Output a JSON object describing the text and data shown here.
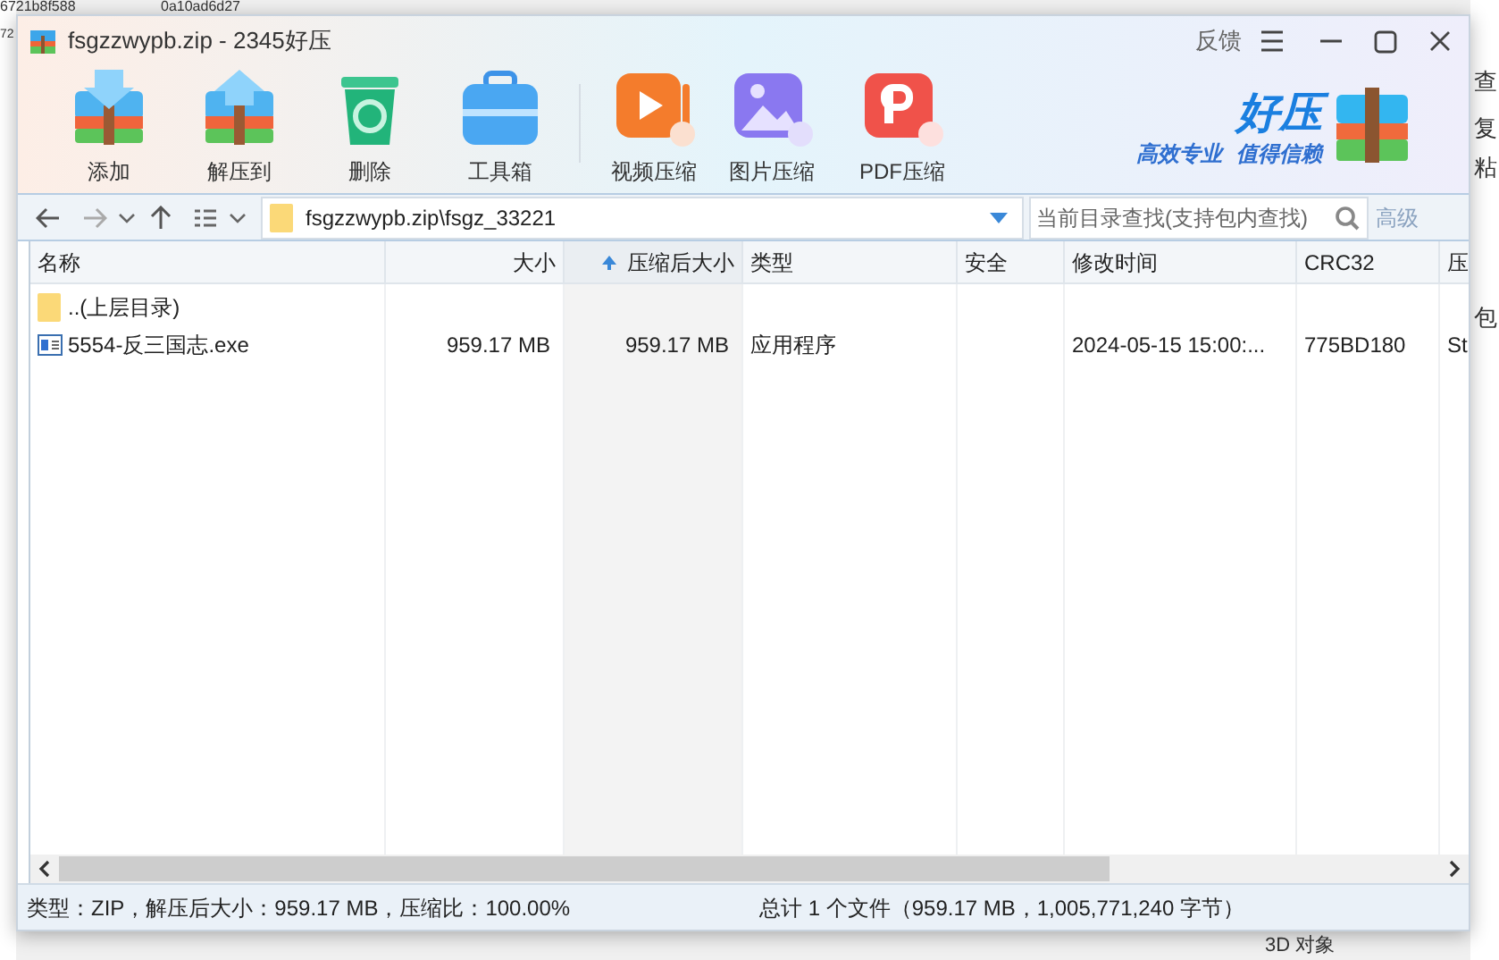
{
  "background": {
    "texts": [
      "6721b8f588",
      "0a10ad6d27",
      "72",
      "查",
      "复",
      "粘",
      "包",
      "3D 对象"
    ]
  },
  "window": {
    "title": "fsgzzwypb.zip - 2345好压",
    "feedback": "反馈"
  },
  "toolbar": [
    {
      "kind": "add",
      "label": "添加"
    },
    {
      "kind": "extract",
      "label": "解压到"
    },
    {
      "kind": "delete",
      "label": "删除"
    },
    {
      "kind": "tools",
      "label": "工具箱"
    },
    {
      "kind": "video",
      "label": "视频压缩"
    },
    {
      "kind": "image",
      "label": "图片压缩"
    },
    {
      "kind": "pdf",
      "label": "PDF压缩"
    }
  ],
  "brand": {
    "name": "好压",
    "slogan": [
      "高效专业",
      "值得信赖"
    ]
  },
  "nav": {
    "path": "fsgzzwypb.zip\\fsgz_33221",
    "search": {
      "placeholder": "当前目录查找(支持包内查找)"
    },
    "advanced": "高级"
  },
  "table": {
    "columns": [
      {
        "label": "名称",
        "sorted": false
      },
      {
        "label": "大小",
        "sorted": false
      },
      {
        "label": "压缩后大小",
        "sorted": true
      },
      {
        "label": "类型",
        "sorted": false
      },
      {
        "label": "安全",
        "sorted": false
      },
      {
        "label": "修改时间",
        "sorted": false
      },
      {
        "label": "CRC32",
        "sorted": false
      },
      {
        "label": "压",
        "sorted": false
      }
    ],
    "rows": [
      {
        "kind": "folder",
        "name": "..(上层目录)"
      },
      {
        "kind": "exe",
        "name": "5554-反三国志.exe",
        "size": "959.17 MB",
        "packed": "959.17 MB",
        "type": "应用程序",
        "modified": "2024-05-15 15:00:...",
        "crc": "775BD180",
        "column_8": "St"
      }
    ]
  },
  "status_bar": {
    "left": "类型：ZIP，解压后大小：959.17 MB，压缩比：100.00%",
    "right": "总计 1 个文件（959.17 MB，1,005,771,240 字节）"
  }
}
